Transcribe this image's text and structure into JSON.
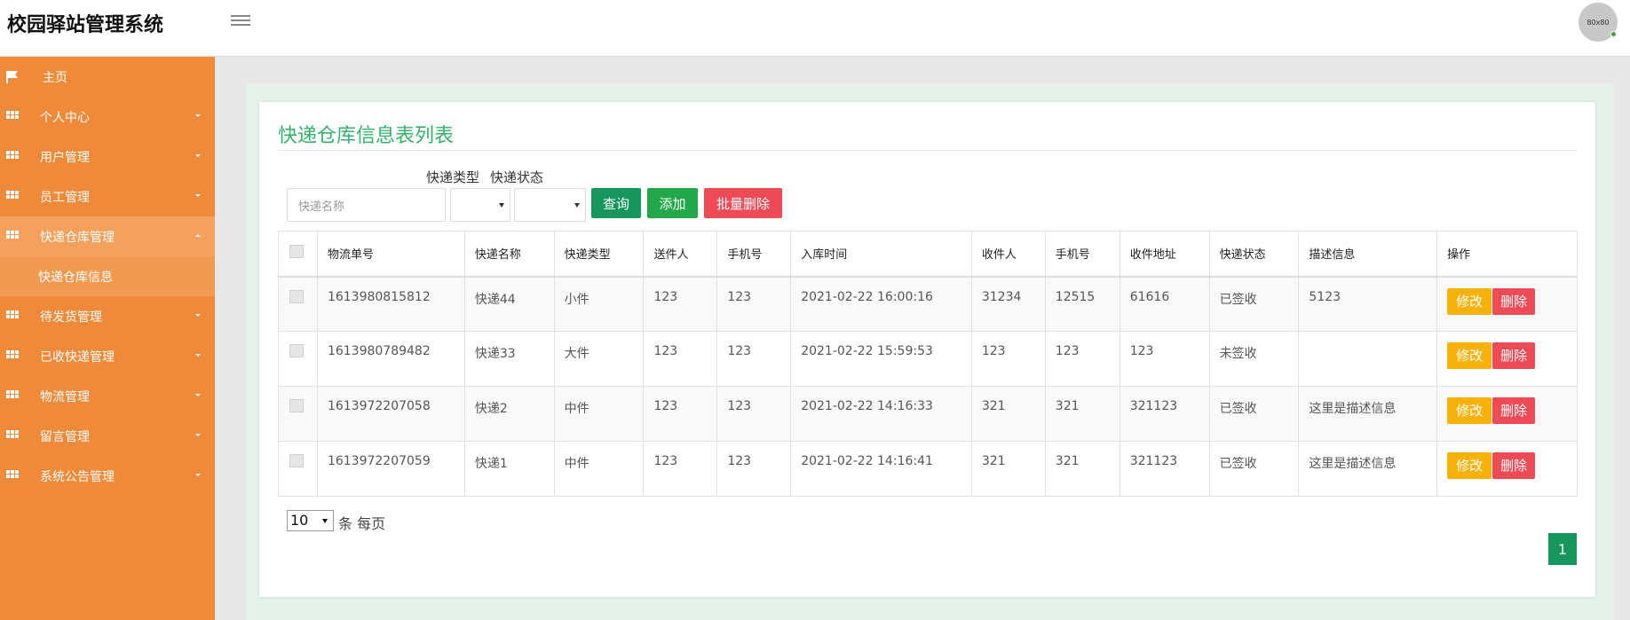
{
  "app": {
    "title": "校园驿站管理系统",
    "avatar_text": "80x80"
  },
  "sidebar": {
    "items": [
      {
        "label": "主页",
        "icon": "flag-icon",
        "active": false
      },
      {
        "label": "个人中心",
        "icon": "grid-icon",
        "active": false
      },
      {
        "label": "用户管理",
        "icon": "grid-icon",
        "active": false
      },
      {
        "label": "员工管理",
        "icon": "grid-icon",
        "active": false
      },
      {
        "label": "快递仓库管理",
        "icon": "grid-icon",
        "active": true,
        "expanded": true
      },
      {
        "label": "待发货管理",
        "icon": "grid-icon",
        "active": false
      },
      {
        "label": "已收快递管理",
        "icon": "grid-icon",
        "active": false
      },
      {
        "label": "物流管理",
        "icon": "grid-icon",
        "active": false
      },
      {
        "label": "留言管理",
        "icon": "grid-icon",
        "active": false
      },
      {
        "label": "系统公告管理",
        "icon": "grid-icon",
        "active": false
      }
    ],
    "sub_item": "快递仓库信息"
  },
  "main": {
    "title": "快递仓库信息表列表",
    "filters": {
      "name_placeholder": "快递名称",
      "type_label": "快递类型",
      "status_label": "快递状态"
    },
    "buttons": {
      "query": "查询",
      "add": "添加",
      "batch_delete": "批量删除"
    },
    "table": {
      "columns": [
        "物流单号",
        "快递名称",
        "快递类型",
        "送件人",
        "手机号",
        "入库时间",
        "收件人",
        "手机号",
        "收件地址",
        "快递状态",
        "描述信息",
        "操作"
      ],
      "rows": [
        [
          "1613980815812",
          "快递44",
          "小件",
          "123",
          "123",
          "2021-02-22 16:00:16",
          "31234",
          "12515",
          "61616",
          "已签收",
          "5123"
        ],
        [
          "1613980789482",
          "快递33",
          "大件",
          "123",
          "123",
          "2021-02-22 15:59:53",
          "123",
          "123",
          "123",
          "未签收",
          ""
        ],
        [
          "1613972207058",
          "快递2",
          "中件",
          "123",
          "123",
          "2021-02-22 14:16:33",
          "321",
          "321",
          "321123",
          "已签收",
          "这里是描述信息"
        ],
        [
          "1613972207059",
          "快递1",
          "中件",
          "123",
          "123",
          "2021-02-22 14:16:41",
          "321",
          "321",
          "321123",
          "已签收",
          "这里是描述信息"
        ]
      ],
      "edit_label": "修改",
      "delete_label": "删除"
    },
    "pagination": {
      "page_size": "10",
      "per_page_text": "条 每页",
      "current_page": "1"
    }
  },
  "colors": {
    "sidebar": "#ef8a3a",
    "accent": "#34b26c",
    "primary_btn": "#16955d",
    "danger": "#ef4b56",
    "warning": "#f6b20a"
  }
}
